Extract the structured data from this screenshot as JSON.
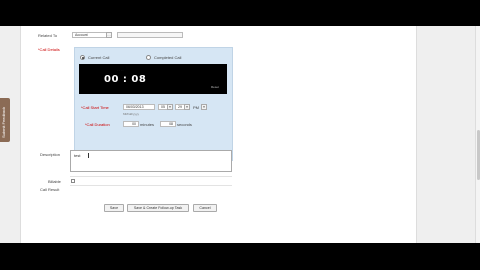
{
  "form": {
    "related_to": {
      "label": "Related To",
      "value": "Account"
    },
    "call_details": {
      "label": "*Call Details"
    },
    "call_type": {
      "current_label": "Current Call",
      "completed_label": "Completed Call"
    },
    "timer": {
      "display": "00 : 08",
      "reset_label": "Reset"
    },
    "start_time": {
      "label": "*Call Start Time",
      "date": "06/03/2013",
      "hour": "05",
      "minute": "29",
      "ampm": "PM",
      "format": "MM/dd/yyyy"
    },
    "duration": {
      "label": "*Call Duration",
      "minutes": "00",
      "minutes_label": "minutes",
      "seconds": "08",
      "seconds_label": "seconds"
    },
    "description": {
      "label": "Description",
      "value": "test"
    },
    "billable": {
      "label": "Billable"
    },
    "call_result": {
      "label": "Call Result"
    },
    "buttons": {
      "save": "Save",
      "save_followup": "Save & Create Follow-up Task",
      "cancel": "Cancel"
    }
  },
  "feedback_tab": {
    "label": "Submit Feedback"
  }
}
